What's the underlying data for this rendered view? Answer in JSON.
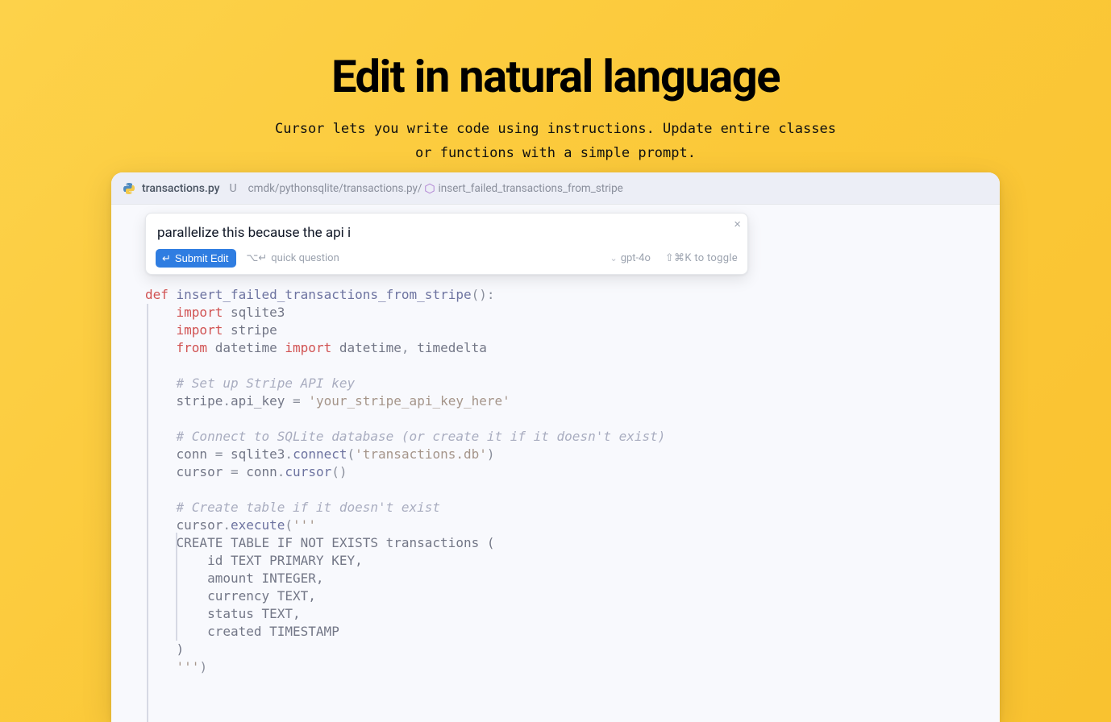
{
  "hero": {
    "title": "Edit in natural language",
    "subtitle": "Cursor lets you write code using instructions. Update entire classes or functions with a simple prompt."
  },
  "tab": {
    "filename": "transactions.py",
    "modified_marker": "U",
    "breadcrumb_path": "cmdk/pythonsqlite/transactions.py/",
    "breadcrumb_fn": "insert_failed_transactions_from_stripe"
  },
  "prompt": {
    "input_value": "parallelize this because the api i",
    "submit_label": "Submit Edit",
    "quick_question_label": "quick question",
    "quick_question_kbd": "⌥↵",
    "model_label": "gpt-4o",
    "toggle_hint": "⇧⌘K to toggle"
  },
  "code": {
    "def_kw": "def",
    "fn_name": "insert_failed_transactions_from_stripe",
    "import_kw": "import",
    "from_kw": "from",
    "sqlite3": "sqlite3",
    "stripe": "stripe",
    "datetime_mod": "datetime",
    "datetime_name": "datetime",
    "timedelta": "timedelta",
    "cmt1": "# Set up Stripe API key",
    "api_key_lhs": "stripe",
    "api_key_attr": "api_key",
    "api_key_str": "'your_stripe_api_key_here'",
    "cmt2": "# Connect to SQLite database (or create it if it doesn't exist)",
    "conn": "conn",
    "connect": "connect",
    "db_str": "'transactions.db'",
    "cursor_var": "cursor",
    "cursor_m": "cursor",
    "cmt3": "# Create table if it doesn't exist",
    "execute": "execute",
    "triple_open": "'''",
    "sql_l1": "    CREATE TABLE IF NOT EXISTS transactions (",
    "sql_l2": "        id TEXT PRIMARY KEY,",
    "sql_l3": "        amount INTEGER,",
    "sql_l4": "        currency TEXT,",
    "sql_l5": "        status TEXT,",
    "sql_l6": "        created TIMESTAMP",
    "sql_l7": "    )",
    "triple_close": "    '''"
  }
}
